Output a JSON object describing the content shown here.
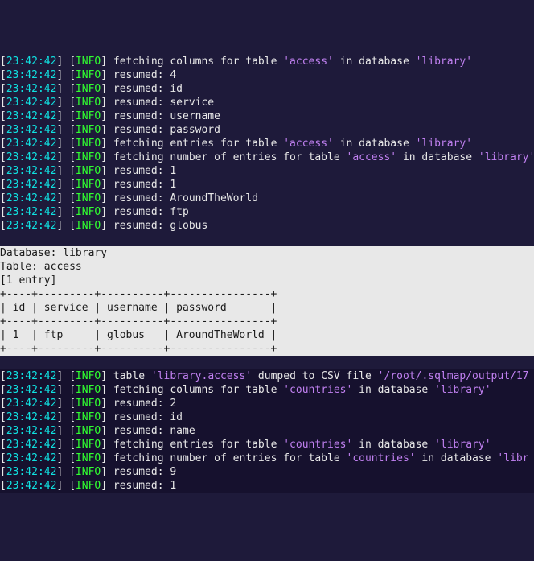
{
  "ts": "23:42:42",
  "lvl": "INFO",
  "block1": [
    {
      "pre": "fetching columns for table ",
      "s1": "'access'",
      "mid": " in database ",
      "s2": "'library'"
    },
    {
      "pre": "resumed: 4"
    },
    {
      "pre": "resumed: id"
    },
    {
      "pre": "resumed: service"
    },
    {
      "pre": "resumed: username"
    },
    {
      "pre": "resumed: password"
    },
    {
      "pre": "fetching entries for table ",
      "s1": "'access'",
      "mid": " in database ",
      "s2": "'library'"
    },
    {
      "pre": "fetching number of entries for table ",
      "s1": "'access'",
      "mid": " in database ",
      "s2": "'library'"
    },
    {
      "pre": "resumed: 1"
    },
    {
      "pre": "resumed: 1"
    },
    {
      "pre": "resumed: AroundTheWorld"
    },
    {
      "pre": "resumed: ftp"
    },
    {
      "pre": "resumed: globus"
    }
  ],
  "dump": {
    "db": "Database: library",
    "tbl": "Table: access",
    "cnt": "[1 entry]",
    "sep": "+----+---------+----------+----------------+",
    "hdr": "| id | service | username | password       |",
    "row": "| 1  | ftp     | globus   | AroundTheWorld |",
    "blank": ""
  },
  "block2": [
    {
      "pre": "table ",
      "s1": "'library.access'",
      "mid": " dumped to CSV file ",
      "s2": "'/root/.sqlmap/output/17"
    },
    {
      "pre": "fetching columns for table ",
      "s1": "'countries'",
      "mid": " in database ",
      "s2": "'library'"
    },
    {
      "pre": "resumed: 2"
    },
    {
      "pre": "resumed: id"
    },
    {
      "pre": "resumed: name"
    },
    {
      "pre": "fetching entries for table ",
      "s1": "'countries'",
      "mid": " in database ",
      "s2": "'library'"
    },
    {
      "pre": "fetching number of entries for table ",
      "s1": "'countries'",
      "mid": " in database ",
      "s2": "'libr"
    },
    {
      "pre": "resumed: 9"
    },
    {
      "pre": "resumed: 1"
    }
  ]
}
